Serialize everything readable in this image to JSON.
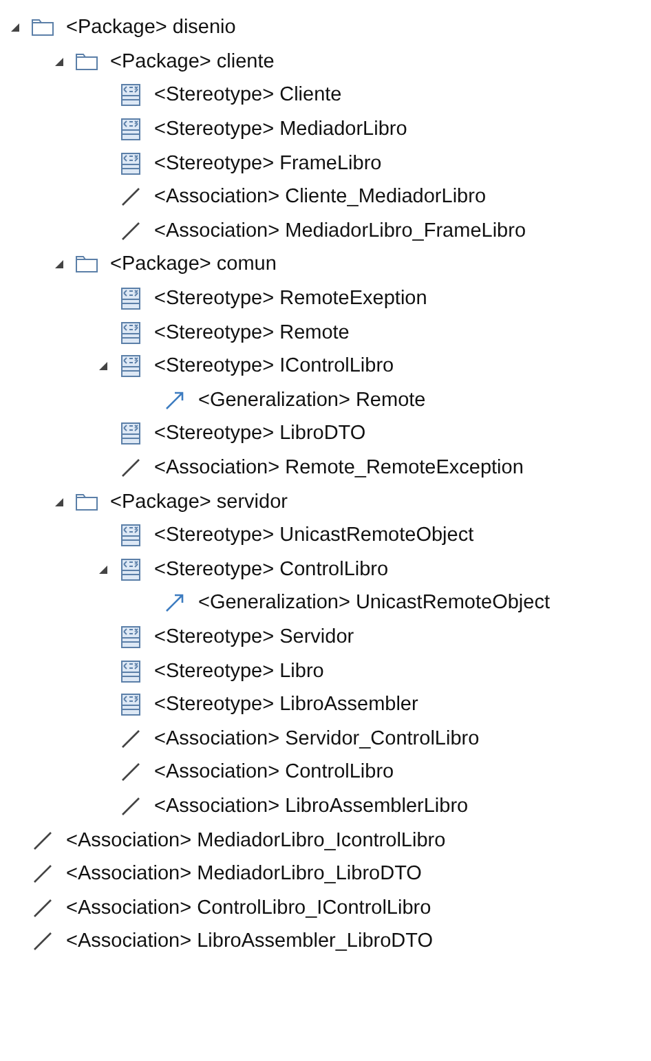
{
  "tree": [
    {
      "kind": "package",
      "label": "<Package> disenio",
      "expanded": true,
      "children": [
        {
          "kind": "package",
          "label": "<Package> cliente",
          "expanded": true,
          "children": [
            {
              "kind": "stereotype",
              "label": "<Stereotype> Cliente"
            },
            {
              "kind": "stereotype",
              "label": "<Stereotype> MediadorLibro"
            },
            {
              "kind": "stereotype",
              "label": "<Stereotype> FrameLibro"
            },
            {
              "kind": "association",
              "label": "<Association> Cliente_MediadorLibro"
            },
            {
              "kind": "association",
              "label": "<Association> MediadorLibro_FrameLibro"
            }
          ]
        },
        {
          "kind": "package",
          "label": "<Package> comun",
          "expanded": true,
          "children": [
            {
              "kind": "stereotype",
              "label": "<Stereotype> RemoteExeption"
            },
            {
              "kind": "stereotype",
              "label": "<Stereotype> Remote"
            },
            {
              "kind": "stereotype",
              "label": "<Stereotype> IControlLibro",
              "expanded": true,
              "children": [
                {
                  "kind": "generalization",
                  "label": "<Generalization> Remote"
                }
              ]
            },
            {
              "kind": "stereotype",
              "label": "<Stereotype> LibroDTO"
            },
            {
              "kind": "association",
              "label": "<Association> Remote_RemoteException"
            }
          ]
        },
        {
          "kind": "package",
          "label": "<Package> servidor",
          "expanded": true,
          "children": [
            {
              "kind": "stereotype",
              "label": "<Stereotype> UnicastRemoteObject"
            },
            {
              "kind": "stereotype",
              "label": "<Stereotype> ControlLibro",
              "expanded": true,
              "children": [
                {
                  "kind": "generalization",
                  "label": "<Generalization> UnicastRemoteObject"
                }
              ]
            },
            {
              "kind": "stereotype",
              "label": "<Stereotype> Servidor"
            },
            {
              "kind": "stereotype",
              "label": "<Stereotype> Libro"
            },
            {
              "kind": "stereotype",
              "label": "<Stereotype> LibroAssembler"
            },
            {
              "kind": "association",
              "label": "<Association> Servidor_ControlLibro"
            },
            {
              "kind": "association",
              "label": "<Association> ControlLibro"
            },
            {
              "kind": "association",
              "label": "<Association> LibroAssemblerLibro"
            }
          ]
        }
      ]
    },
    {
      "kind": "association",
      "label": "<Association> MediadorLibro_IcontrolLibro"
    },
    {
      "kind": "association",
      "label": "<Association> MediadorLibro_LibroDTO"
    },
    {
      "kind": "association",
      "label": "<Association> ControlLibro_IControlLibro"
    },
    {
      "kind": "association",
      "label": "<Association> LibroAssembler_LibroDTO"
    }
  ]
}
